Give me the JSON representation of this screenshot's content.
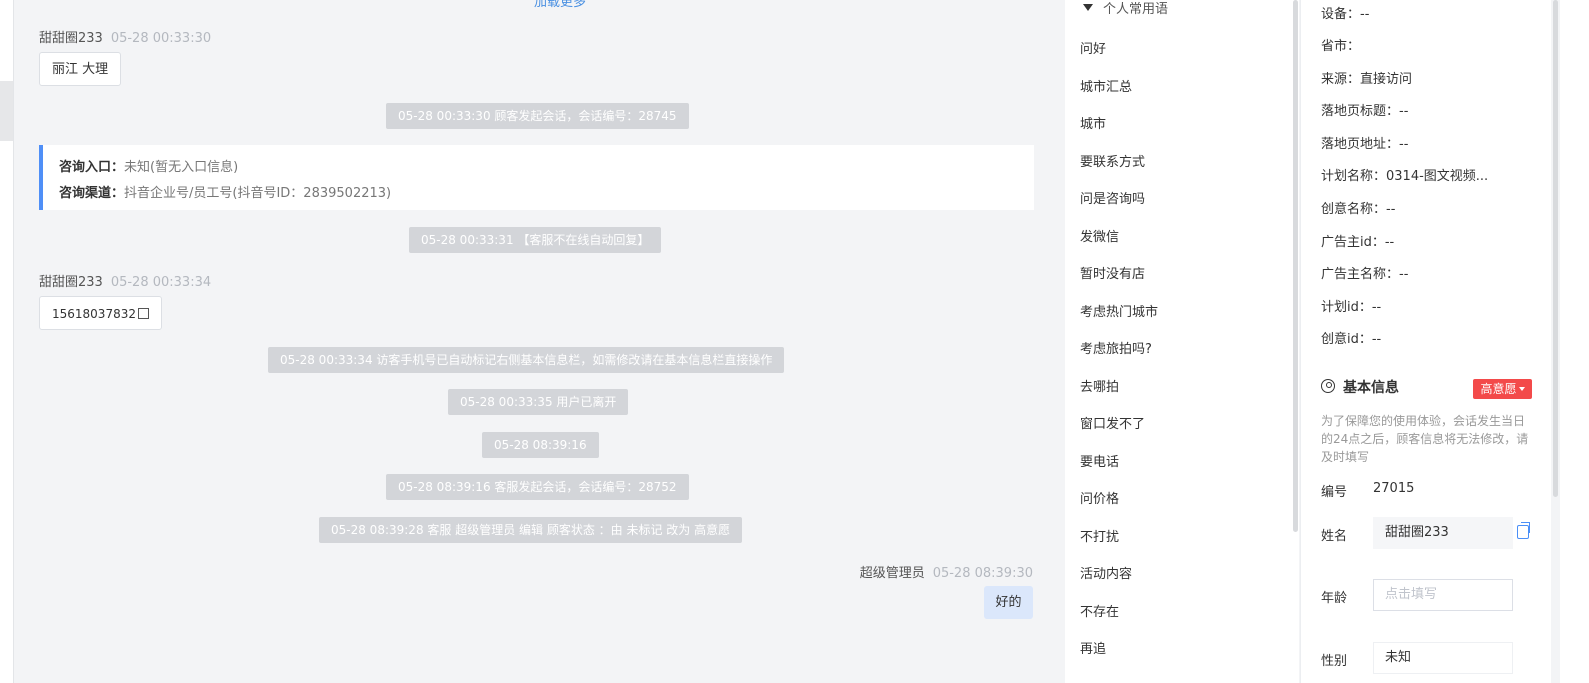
{
  "chat": {
    "load_more": "加载更多",
    "messages": {
      "m1": {
        "sender": "甜甜圈233",
        "time": "05-28 00:33:30",
        "text": "丽江 大理"
      },
      "s1": "05-28 00:33:30 顾客发起会话，会话编号：28745",
      "entry": {
        "label1": "咨询入口：",
        "value1": "未知(暂无入口信息)",
        "label2": "咨询渠道：",
        "value2": "抖音企业号/员工号(抖音号ID：2839502213)"
      },
      "s2": "05-28 00:33:31 【客服不在线自动回复】",
      "m2": {
        "sender": "甜甜圈233",
        "time": "05-28 00:33:34",
        "text": "15618037832"
      },
      "s3": "05-28 00:33:34 访客手机号已自动标记右侧基本信息栏，如需修改请在基本信息栏直接操作",
      "s4": "05-28 00:33:35 用户已离开",
      "s5": "05-28 08:39:16",
      "s6": "05-28 08:39:16 客服发起会话，会话编号：28752",
      "s7": "05-28 08:39:28 客服 超级管理员 编辑 顾客状态 ：由 未标记 改为 高意愿",
      "m3": {
        "sender": "超级管理员",
        "time": "05-28 08:39:30",
        "text": "好的"
      }
    }
  },
  "phrases": {
    "header": "个人常用语",
    "items": [
      "问好",
      "城市汇总",
      "城市",
      "要联系方式",
      "问是咨询吗",
      "发微信",
      "暂时没有店",
      "考虑热门城市",
      "考虑旅拍吗?",
      "去哪拍",
      "窗口发不了",
      "要电话",
      "问价格",
      "不打扰",
      "活动内容",
      "不存在",
      "再追"
    ]
  },
  "info": {
    "device": "设备：--",
    "province": "省市：",
    "source": "来源：直接访问",
    "landing_title": "落地页标题：--",
    "landing_url": "落地页地址：--",
    "plan_name": "计划名称：0314-图文视频...",
    "creative_name": "创意名称：--",
    "advertiser_id": "广告主id：--",
    "advertiser_name": "广告主名称：--",
    "plan_id": "计划id：--",
    "creative_id": "创意id：--",
    "basic_title": "基本信息",
    "intent_badge": "高意愿",
    "notice": "为了保障您的使用体验，会话发生当日的24点之后，顾客信息将无法修改，请及时填写",
    "fields": {
      "number_label": "编号",
      "number_value": "27015",
      "name_label": "姓名",
      "name_value": "甜甜圈233",
      "age_label": "年龄",
      "age_placeholder": "点击填写",
      "gender_label": "性别",
      "gender_value": "未知"
    }
  },
  "colors": {
    "accent": "#4f8ff7",
    "badge": "#f34a4a",
    "sys_bg": "#d3d5d9",
    "bubble_self": "#dbe7fb"
  }
}
